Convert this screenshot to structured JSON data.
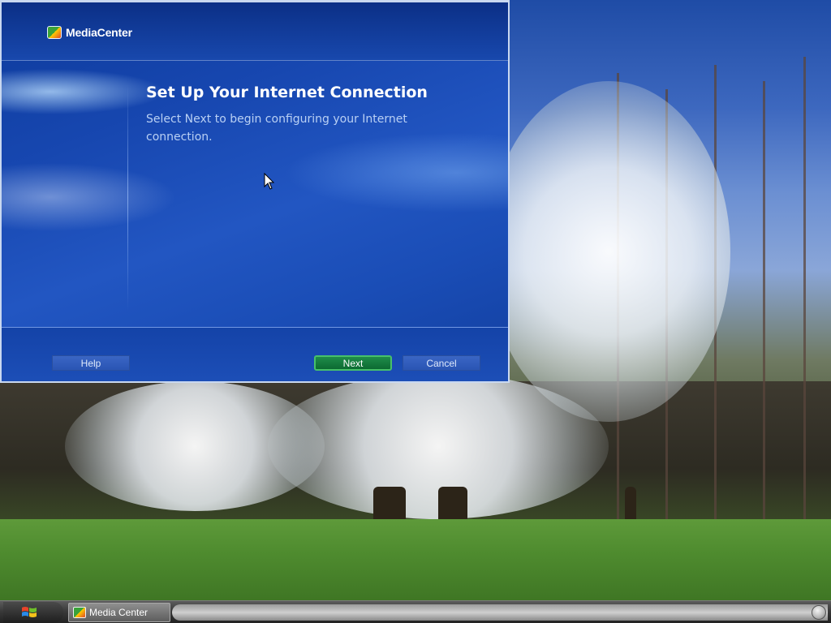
{
  "window": {
    "app_name": "MediaCenter",
    "title": "Set Up Your Internet Connection",
    "subtitle": "Select Next to begin configuring your Internet connection.",
    "buttons": {
      "help": "Help",
      "next": "Next",
      "cancel": "Cancel"
    }
  },
  "taskbar": {
    "start_icon": "windows-flag-icon",
    "items": [
      {
        "label": "Media Center",
        "icon": "media-center-icon"
      }
    ]
  },
  "colors": {
    "window_bg": "#1747b0",
    "next_accent": "#1f8c4a",
    "title_text": "#ffffff",
    "subtitle_text": "#b9d0f4"
  }
}
